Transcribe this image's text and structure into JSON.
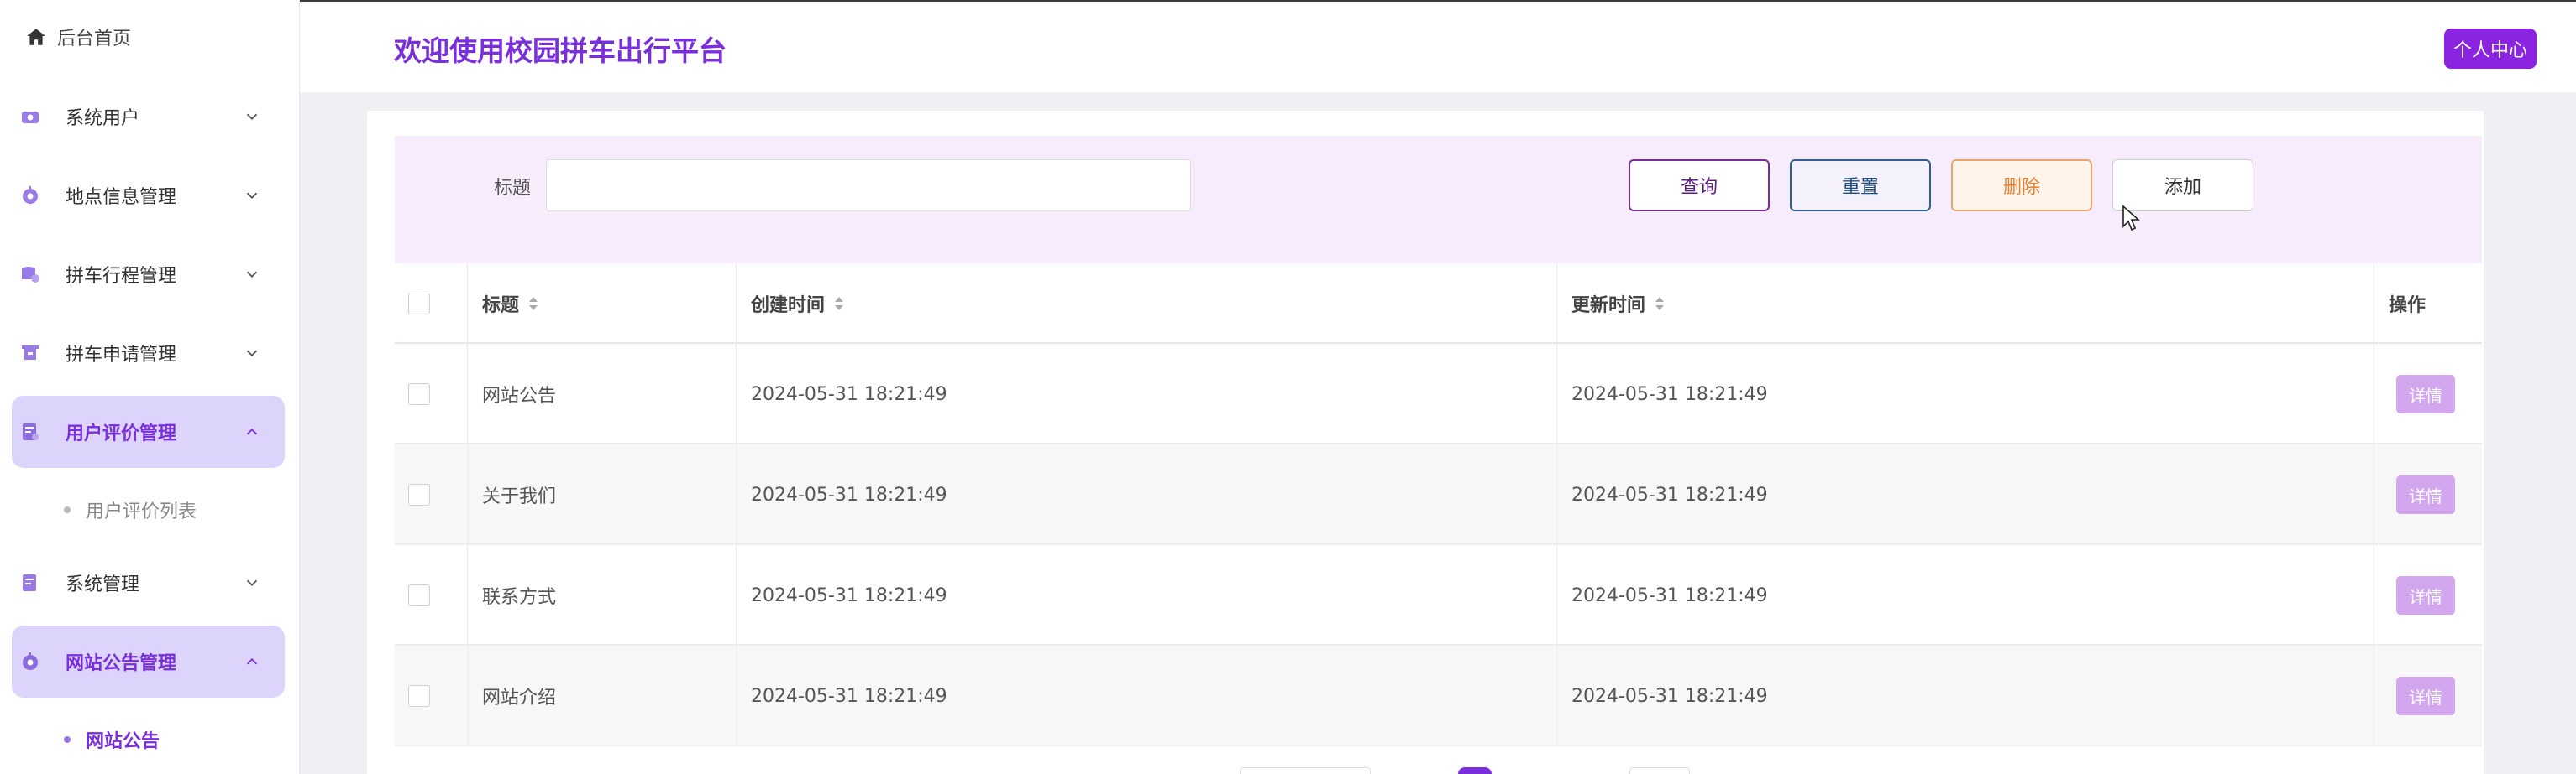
{
  "sidebar": {
    "home_label": "后台首页",
    "items": [
      {
        "label": "系统用户",
        "icon": "users-icon",
        "expanded": false
      },
      {
        "label": "地点信息管理",
        "icon": "location-icon",
        "expanded": false
      },
      {
        "label": "拼车行程管理",
        "icon": "trip-icon",
        "expanded": false
      },
      {
        "label": "拼车申请管理",
        "icon": "application-icon",
        "expanded": false
      },
      {
        "label": "用户评价管理",
        "icon": "review-icon",
        "expanded": true,
        "children": [
          {
            "label": "用户评价列表"
          }
        ]
      },
      {
        "label": "系统管理",
        "icon": "system-icon",
        "expanded": false
      },
      {
        "label": "网站公告管理",
        "icon": "announcement-icon",
        "expanded": true,
        "children": [
          {
            "label": "网站公告",
            "current": true
          }
        ]
      }
    ]
  },
  "header": {
    "title": "欢迎使用校园拼车出行平台",
    "profile_label": "个人中心"
  },
  "search": {
    "title_label": "标题",
    "title_value": "",
    "query_label": "查询",
    "reset_label": "重置",
    "delete_label": "删除",
    "add_label": "添加"
  },
  "table": {
    "columns": [
      "标题",
      "创建时间",
      "更新时间",
      "操作"
    ],
    "rows": [
      {
        "title": "网站公告",
        "created": "2024-05-31 18:21:49",
        "updated": "2024-05-31 18:21:49",
        "action": "详情"
      },
      {
        "title": "关于我们",
        "created": "2024-05-31 18:21:49",
        "updated": "2024-05-31 18:21:49",
        "action": "详情"
      },
      {
        "title": "联系方式",
        "created": "2024-05-31 18:21:49",
        "updated": "2024-05-31 18:21:49",
        "action": "详情"
      },
      {
        "title": "网站介绍",
        "created": "2024-05-31 18:21:49",
        "updated": "2024-05-31 18:21:49",
        "action": "详情"
      }
    ]
  },
  "colors": {
    "accent": "#7a2fdc",
    "profile_button": "#8a24e0",
    "active_nav_bg": "#dcd4fb",
    "search_panel_bg": "#f7ecfc",
    "detail_button": "#d2a7ee"
  }
}
